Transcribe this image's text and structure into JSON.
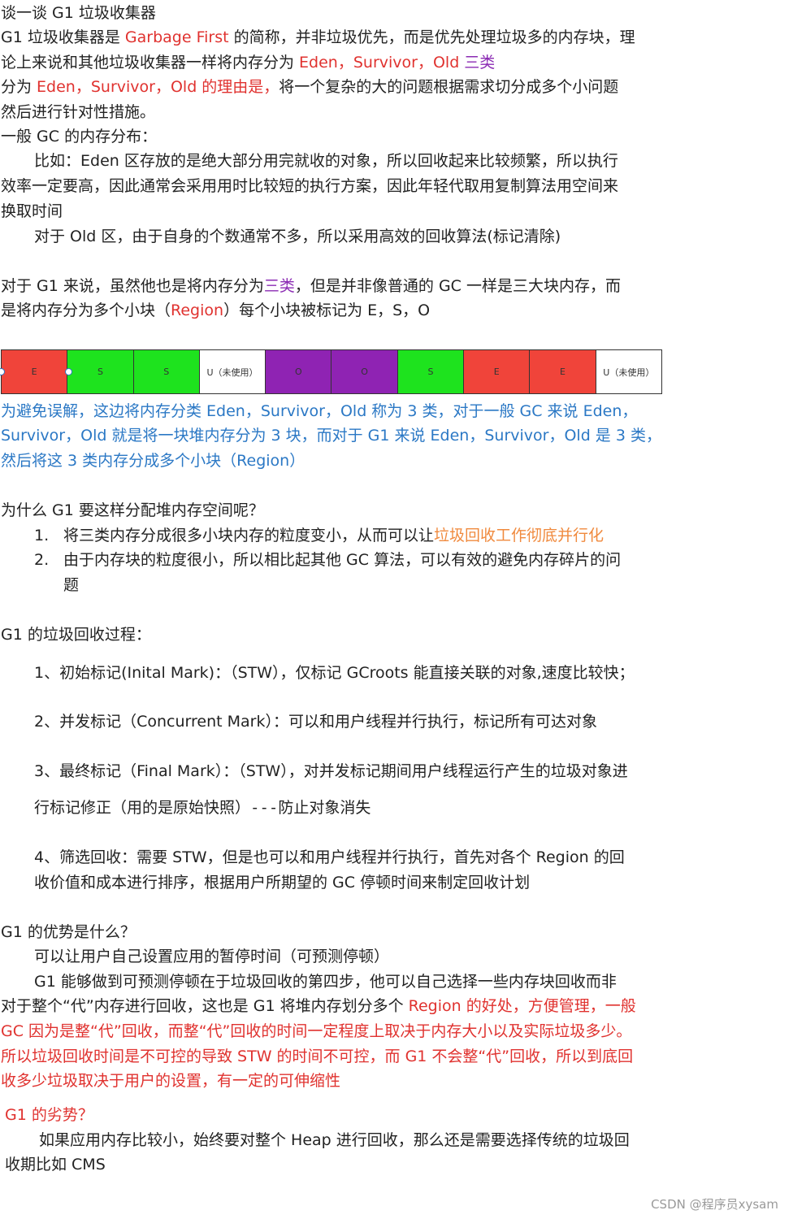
{
  "title": "谈一谈 G1 垃圾收集器",
  "intro": {
    "l1_a": "G1 垃圾收集器是 ",
    "l1_red": "Garbage First",
    "l1_b": " 的简称，并非垃圾优先，而是优先处理垃圾多的内存块，理",
    "l2_a": "论上来说和其他垃圾收集器一样将内存分为 ",
    "l2_red": "Eden，Survivor，Old",
    "l2_purple": " 三类",
    "l3_a": " 分为 ",
    "l3_red": "Eden，Survivor，Old 的理由是，",
    "l3_b": "将一个复杂的大的问题根据需求切分成多个小问题",
    "l4": "然后进行针对性措施。"
  },
  "gc_layout": {
    "heading": "一般 GC 的内存分布：",
    "eden_1": "比如：Eden 区存放的是绝大部分用完就收的对象，所以回收起来比较频繁，所以执行",
    "eden_2": "效率一定要高，因此通常会采用用时比较短的执行方案，因此年轻代取用复制算法用空间来",
    "eden_3": "换取时间",
    "old": "对于 Old 区，由于自身的个数通常不多，所以采用高效的回收算法(标记清除)"
  },
  "g1_regions": {
    "l1_a": "对于 G1 来说，虽然他也是将内存分为",
    "l1_purple": "三类",
    "l1_b": "，但是并非像普通的 GC 一样是三大块内存，而",
    "l2_a": "是将内存分为多个小块（",
    "l2_red": "Region",
    "l2_b": "）每个小块被标记为 E，S，O"
  },
  "region_cells": [
    {
      "label": "E",
      "kind": "eden"
    },
    {
      "label": "S",
      "kind": "surv"
    },
    {
      "label": "S",
      "kind": "surv"
    },
    {
      "label": "U（未使用）",
      "kind": "unused"
    },
    {
      "label": "O",
      "kind": "old"
    },
    {
      "label": "O",
      "kind": "old"
    },
    {
      "label": "S",
      "kind": "surv"
    },
    {
      "label": "E",
      "kind": "eden"
    },
    {
      "label": "E",
      "kind": "eden"
    },
    {
      "label": "U（未使用）",
      "kind": "unused"
    }
  ],
  "clarify": {
    "l1": "为避免误解，这边将内存分类 Eden，Survivor，Old 称为 3 类，对于一般 GC 来说 Eden，",
    "l2": "Survivor，Old 就是将一块堆内存分为 3 块，而对于 G1 来说 Eden，Survivor，Old 是 3 类，",
    "l3": "然后将这 3 类内存分成多个小块（Region）"
  },
  "why": {
    "heading": "为什么 G1 要这样分配堆内存空间呢？",
    "item1_num": "1.",
    "item1_a": "将三类内存分成很多小块内存的粒度变小，从而可以让",
    "item1_orange": "垃圾回收工作彻底并行化",
    "item2_num": "2.",
    "item2_a": "由于内存块的粒度很小，所以相比起其他 GC 算法，可以有效的避免内存碎片的问",
    "item2_b": "题"
  },
  "process": {
    "heading": "G1 的垃圾回收过程：",
    "step1": "1、初始标记(Inital Mark)：（STW），仅标记 GCroots 能直接关联的对象,速度比较快；",
    "step2": "2、并发标记（Concurrent Mark）：可以和用户线程并行执行，标记所有可达对象",
    "step3_a": "3、最终标记（Final Mark）：（STW），对并发标记期间用户线程运行产生的垃圾对象进",
    "step3_b1": "行标记修正（用的是原始快照）",
    "step3_b_mono": "---",
    "step3_b2": "防止对象消失",
    "step4_a": "4、筛选回收：需要 STW，但是也可以和用户线程并行执行，首先对各个 Region 的回",
    "step4_b": "收价值和成本进行排序，根据用户所期望的 GC 停顿时间来制定回收计划"
  },
  "advantages": {
    "heading": "G1 的优势是什么？",
    "p1": "可以让用户自己设置应用的暂停时间（可预测停顿）",
    "p2_l1": "G1 能够做到可预测停顿在于垃圾回收的第四步，他可以自己选择一些内存块回收而非",
    "p2_l2_a": "对于整个“代”内存进行回收，这也是 G1 将堆内存划分多个 ",
    "p2_l2_red": "Region 的好处，方便管理，一般",
    "p2_l3": "GC 因为是整“代”回收，而整“代”回收的时间一定程度上取决于内存大小以及实际垃圾多少。",
    "p2_l4": "所以垃圾回收时间是不可控的导致 STW 的时间不可控，而 G1 不会整“代”回收，所以到底回",
    "p2_l5": "收多少垃圾取决于用户的设置，有一定的可伸缩性"
  },
  "disadvantages": {
    "heading": "G1 的劣势？",
    "l1": "如果应用内存比较小，始终要对整个 Heap 进行回收，那么还是需要选择传统的垃圾回",
    "l2": "收期比如 CMS"
  },
  "watermark": "CSDN @程序员xysam",
  "colors": {
    "eden": "#f0443a",
    "survivor": "#1ee31e",
    "old": "#8f23b3",
    "unused": "#ffffff",
    "red_text": "#e0322f",
    "blue_text": "#2b78c5",
    "orange_text": "#f08a3e",
    "purple_text": "#8b2bb3"
  }
}
